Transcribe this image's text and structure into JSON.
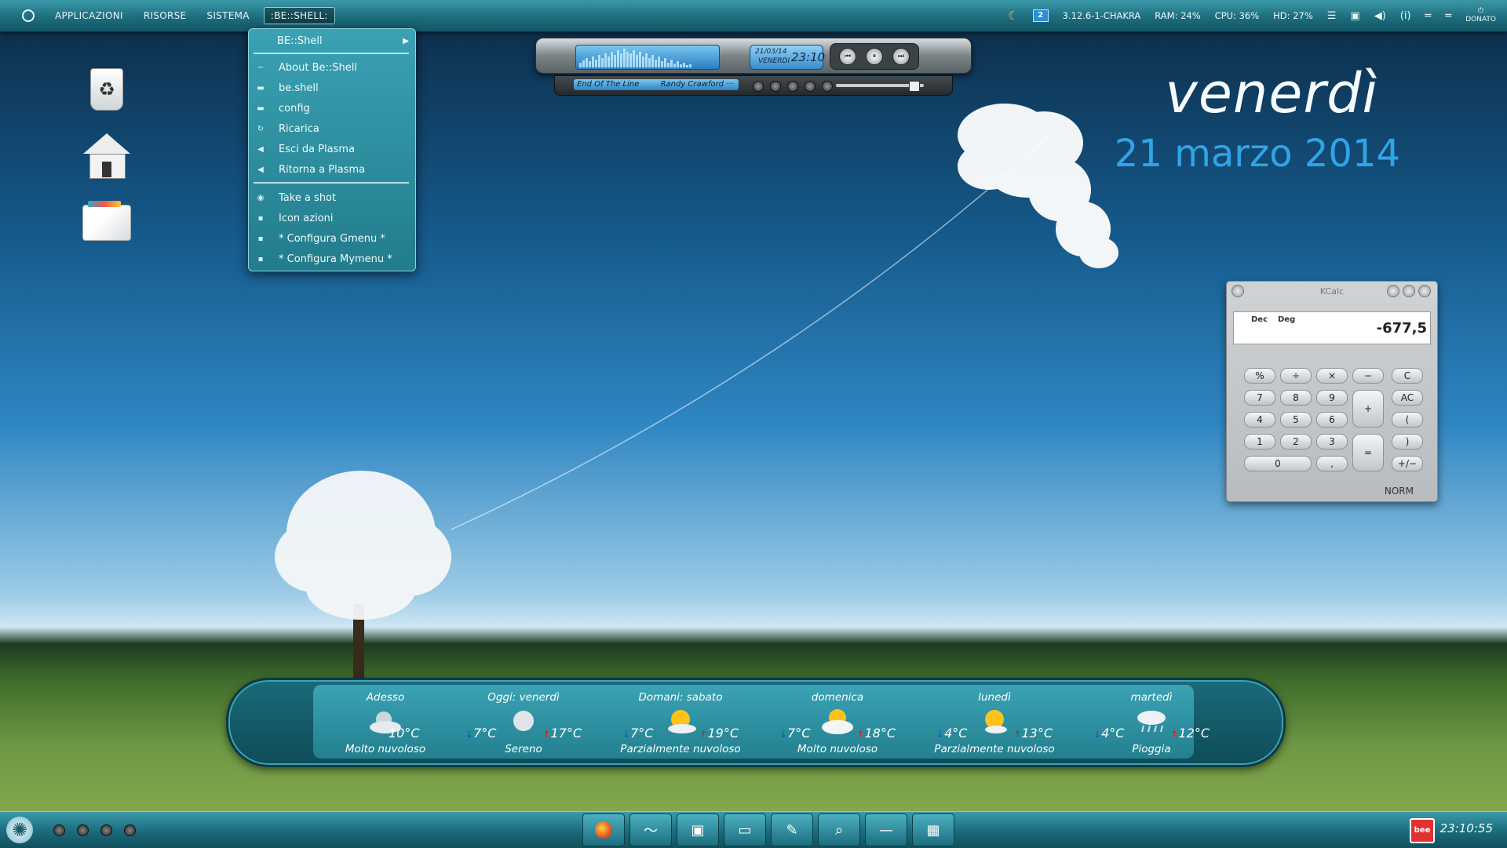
{
  "top_panel": {
    "menus": [
      "APPLICAZIONI",
      "RISORSE",
      "SISTEMA",
      ":BE::SHELL:"
    ],
    "kernel": "3.12.6-1-CHAKRA",
    "ram": "RAM: 24%",
    "cpu": "CPU: 36%",
    "hd": "HD: 27%",
    "desktop_badge": "2",
    "info_label": "(i)",
    "user": "DONATO"
  },
  "dropdown": {
    "header": "BE::Shell",
    "items": [
      "About Be::Shell",
      "be.shell",
      "config",
      "Ricarica",
      "Esci da Plasma",
      "Ritorna a Plasma"
    ],
    "items2": [
      "Take a shot",
      "Icon azioni",
      "* Configura Gmenu *",
      "* Configura Mymenu *"
    ]
  },
  "player": {
    "date": "21/03/14",
    "day": "VENERDI",
    "time": "23:10",
    "track": "End Of The Line",
    "artist": "Randy Crawford ···",
    "volume": 0.88
  },
  "date_widget": {
    "day_name": "venerdì",
    "full_date": "21 marzo 2014"
  },
  "kcalc": {
    "title": "KCalc",
    "mode1": "Dec",
    "mode2": "Deg",
    "value": "-677,5",
    "status": "NORM",
    "buttons": [
      "%",
      "÷",
      "×",
      "−",
      "C",
      "7",
      "8",
      "9",
      "+",
      "AC",
      "4",
      "5",
      "6",
      "(",
      "1",
      "2",
      "3",
      "=",
      ")",
      "0",
      ",",
      "+/−"
    ]
  },
  "weather": {
    "days": [
      {
        "name": "Adesso",
        "current": "10°C",
        "cond": "Molto nuvoloso",
        "icon": "cloudy-night-icon"
      },
      {
        "name": "Oggi: venerdì",
        "low": "7°C",
        "high": "17°C",
        "cond": "Sereno",
        "icon": "clear-night-icon"
      },
      {
        "name": "Domani: sabato",
        "low": "7°C",
        "high": "19°C",
        "cond": "Parzialmente nuvoloso",
        "icon": "partly-cloudy-icon"
      },
      {
        "name": "domenica",
        "low": "7°C",
        "high": "18°C",
        "cond": "Molto nuvoloso",
        "icon": "mostly-cloudy-icon"
      },
      {
        "name": "lunedì",
        "low": "4°C",
        "high": "13°C",
        "cond": "Parzialmente nuvoloso",
        "icon": "partly-cloudy-icon"
      },
      {
        "name": "martedì",
        "low": "4°C",
        "high": "12°C",
        "cond": "Pioggia",
        "icon": "rain-icon"
      }
    ]
  },
  "taskbar": {
    "clock": "23:10:55",
    "tray_label": "bee"
  }
}
